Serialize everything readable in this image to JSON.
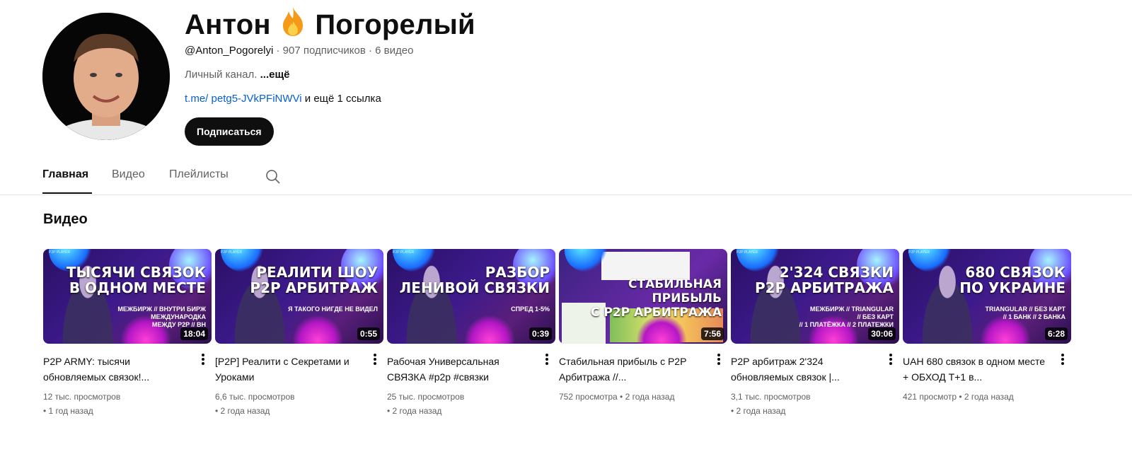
{
  "channel": {
    "name_first": "Антон",
    "name_last": "Погорелый",
    "flame_icon": "fire-emoji",
    "handle": "@Anton_Pogorelyi",
    "meta_rest": " · 907 подписчиков · 6 видео",
    "description": "Личный канал. ",
    "description_more": "...ещё",
    "link_text": "t.me/ petg5-JVkPFiNWVi",
    "link_rest": " и ещё 1 ссылка",
    "subscribe_label": "Подписаться"
  },
  "tabs": [
    {
      "label": "Главная",
      "active": true
    },
    {
      "label": "Видео",
      "active": false
    },
    {
      "label": "Плейлисты",
      "active": false
    }
  ],
  "section": {
    "title": "Видео"
  },
  "videos": [
    {
      "thumb_label": "P2P PLAYER",
      "thumb_text": "ТЫСЯЧИ СВЯЗОК\nВ ОДНОМ МЕСТЕ",
      "thumb_sub": "МЕЖБИРЖ // ВНУТРИ БИРЖ\nМЕЖДУНАРОДКА\nМЕЖДУ P2P // ВН",
      "duration": "18:04",
      "title": "P2P ARMY: тысячи обновляемых связок!...",
      "meta_line1": "12 тыс. просмотров",
      "meta_line2": "• 1 год назад"
    },
    {
      "thumb_label": "P2P PLAYER",
      "thumb_text": "РЕАЛИТИ ШОУ\nP2P АРБИТРАЖ",
      "thumb_sub": "Я ТАКОГО НИГДЕ НЕ ВИДЕЛ",
      "duration": "0:55",
      "title": "[P2P] Реалити с Секретами и Уроками",
      "meta_line1": "6,6 тыс. просмотров",
      "meta_line2": "• 2 года назад"
    },
    {
      "thumb_label": "P2P PLAYER",
      "thumb_text": "РАЗБОР\nЛЕНИВОЙ СВЯЗКИ",
      "thumb_sub": "СПРЕД 1-5%",
      "duration": "0:39",
      "title": "Рабочая Универсальная СВЯЗКА #p2p #связки",
      "meta_line1": "25 тыс. просмотров",
      "meta_line2": "• 2 года назад"
    },
    {
      "thumb_label": "",
      "thumb_text": "СТАБИЛЬНАЯ ПРИБЫЛЬ\nС P2P АРБИТРАЖА",
      "thumb_sub": "",
      "duration": "7:56",
      "title": "Стабильная прибыль с P2P Арбитража //...",
      "meta_line1": "752 просмотра • 2 года назад",
      "meta_line2": ""
    },
    {
      "thumb_label": "P2P PLAYER",
      "thumb_text": "2'324 СВЯЗКИ\nP2P АРБИТРАЖА",
      "thumb_sub": "МЕЖБИРЖ // TRIANGULAR\n// БЕЗ КАРТ\n// 1 ПЛАТЁЖКА // 2 ПЛАТЕЖКИ",
      "duration": "30:06",
      "title": "P2P арбитраж 2'324 обновляемых связок |...",
      "meta_line1": "3,1 тыс. просмотров",
      "meta_line2": "• 2 года назад"
    },
    {
      "thumb_label": "P2P PLAYER",
      "thumb_text": "680 СВЯЗОК\nПО УКРАИНЕ",
      "thumb_sub": "TRIANGULAR // БЕЗ КАРТ\n// 1 БАНК // 2 БАНКА",
      "duration": "6:28",
      "title": "UAH 680 связок в одном месте + ОБХОД Т+1 в...",
      "meta_line1": "421 просмотр • 2 года назад",
      "meta_line2": ""
    }
  ],
  "colors": {
    "link": "#065fd4",
    "subscribe_bg": "#0f0f0f",
    "secondary_text": "#606060"
  }
}
